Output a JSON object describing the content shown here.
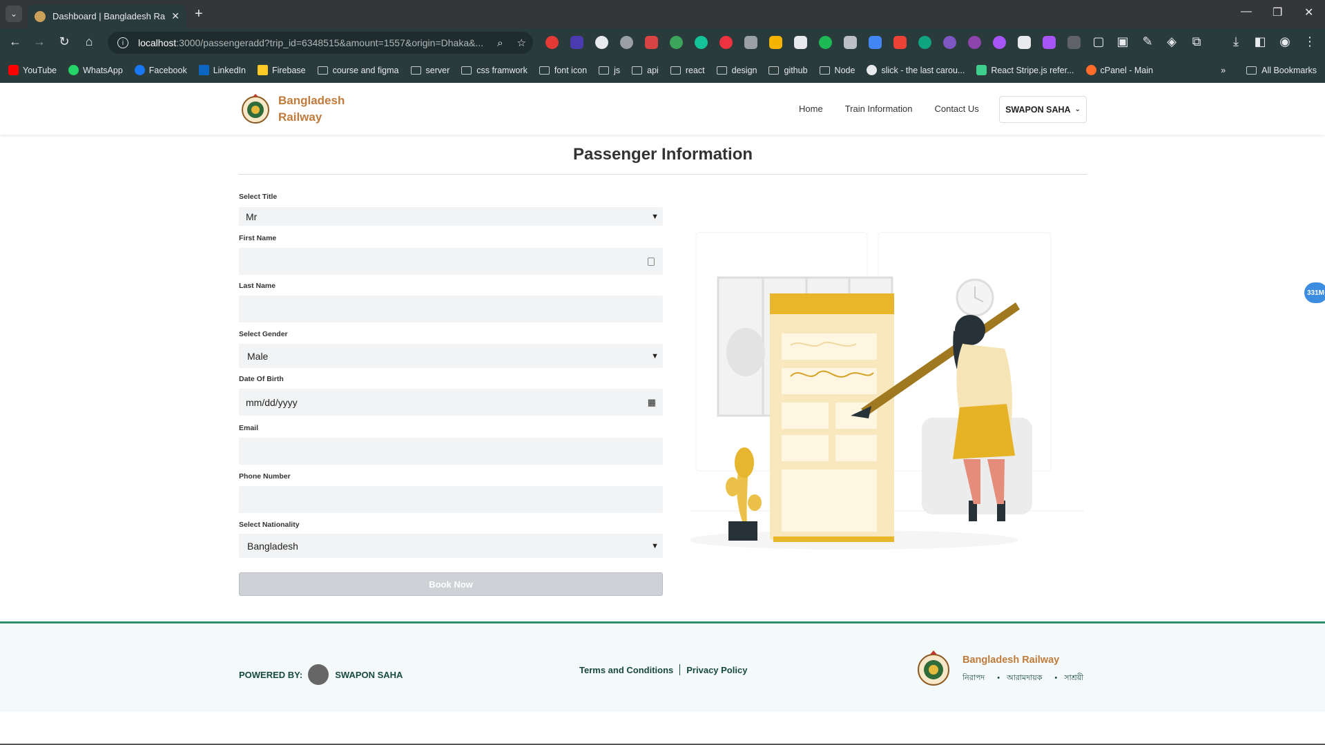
{
  "browser": {
    "tab_title": "Dashboard | Bangladesh Railwa",
    "url_host": "localhost",
    "url_rest": ":3000/passengeradd?trip_id=6348515&amount=1557&origin=Dhaka&...",
    "bookmarks": [
      "YouTube",
      "WhatsApp",
      "Facebook",
      "LinkedIn",
      "Firebase",
      "course and figma",
      "server",
      "css framwork",
      "font icon",
      "js",
      "api",
      "react",
      "design",
      "github",
      "Node",
      "slick - the last carou...",
      "React Stripe.js refer...",
      "cPanel - Main"
    ],
    "all_bookmarks": "All Bookmarks"
  },
  "header": {
    "brand_line1": "Bangladesh",
    "brand_line2": "Railway",
    "nav": {
      "home": "Home",
      "train_info": "Train Information",
      "contact": "Contact Us"
    },
    "user": "SWAPON SAHA"
  },
  "main": {
    "title": "Passenger Information",
    "fields": {
      "title_label": "Select Title",
      "title_value": "Mr",
      "first_name_label": "First Name",
      "first_name_value": "",
      "last_name_label": "Last Name",
      "last_name_value": "",
      "gender_label": "Select Gender",
      "gender_value": "Male",
      "dob_label": "Date Of Birth",
      "dob_placeholder": "mm/dd/yyyy",
      "email_label": "Email",
      "email_value": "",
      "phone_label": "Phone Number",
      "phone_value": "",
      "nationality_label": "Select Nationality",
      "nationality_value": "Bangladesh"
    },
    "submit": "Book Now",
    "badge": "331M"
  },
  "footer": {
    "powered_by": "POWERED BY:",
    "powered_name": "SWAPON SAHA",
    "terms": "Terms and Conditions",
    "privacy": "Privacy Policy",
    "brand": "Bangladesh Railway",
    "tagline": [
      "নিরাপদ",
      "আরামদায়ক",
      "সাশ্রয়ী"
    ]
  },
  "colors": {
    "brand": "#c07b3c",
    "footer_text": "#184a3c",
    "footer_border": "#2e8b6d",
    "accent_yellow": "#ecb72b"
  }
}
